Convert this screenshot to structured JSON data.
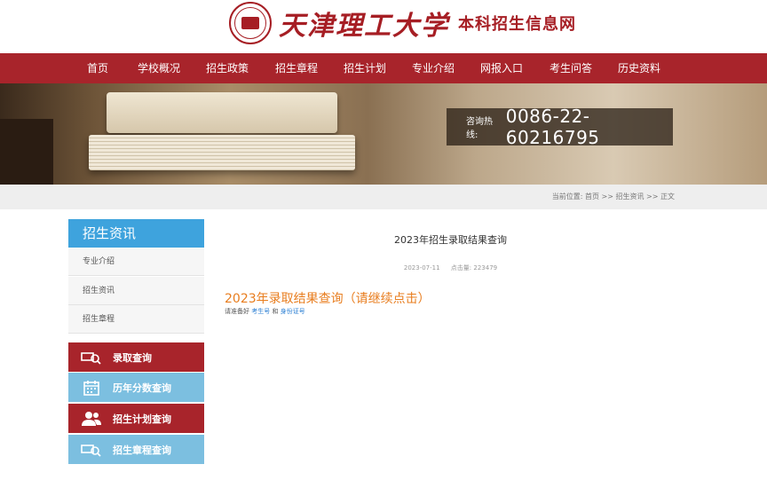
{
  "header": {
    "school_name": "天津理工大学",
    "site_name": "本科招生信息网"
  },
  "nav": {
    "items": [
      {
        "label": "首页"
      },
      {
        "label": "学校概况"
      },
      {
        "label": "招生政策"
      },
      {
        "label": "招生章程"
      },
      {
        "label": "招生计划"
      },
      {
        "label": "专业介绍"
      },
      {
        "label": "网报入口"
      },
      {
        "label": "考生问答"
      },
      {
        "label": "历史资料"
      }
    ]
  },
  "banner": {
    "hotline_label": "咨询热线:",
    "hotline_number": "0086-22-60216795"
  },
  "breadcrumb": {
    "text": "当前位置: 首页 >> 招生资讯 >> 正文"
  },
  "sidebar": {
    "title": "招生资讯",
    "links": [
      {
        "label": "专业介绍"
      },
      {
        "label": "招生资讯"
      },
      {
        "label": "招生章程"
      }
    ],
    "quick_links": [
      {
        "label": "录取查询",
        "icon": "search-card-icon",
        "color": "#a8242b"
      },
      {
        "label": "历年分数查询",
        "icon": "calendar-icon",
        "color": "#7cbfe0"
      },
      {
        "label": "招生计划查询",
        "icon": "users-icon",
        "color": "#a8242b"
      },
      {
        "label": "招生章程查询",
        "icon": "search-card-icon",
        "color": "#7cbfe0"
      }
    ]
  },
  "article": {
    "title": "2023年招生录取结果查询",
    "date": "2023-07-11",
    "views_label": "点击量:",
    "views": "223479",
    "link_text": "2023年录取结果查询（请继续点击）",
    "note_prefix": "请准备好",
    "note_exam_no": "考生号",
    "note_and": "和",
    "note_id_no": "身份证号"
  },
  "colors": {
    "brand_red": "#a8242b",
    "accent_blue": "#3ea3dd",
    "light_blue": "#7cbfe0",
    "link_orange": "#e87d1e"
  }
}
